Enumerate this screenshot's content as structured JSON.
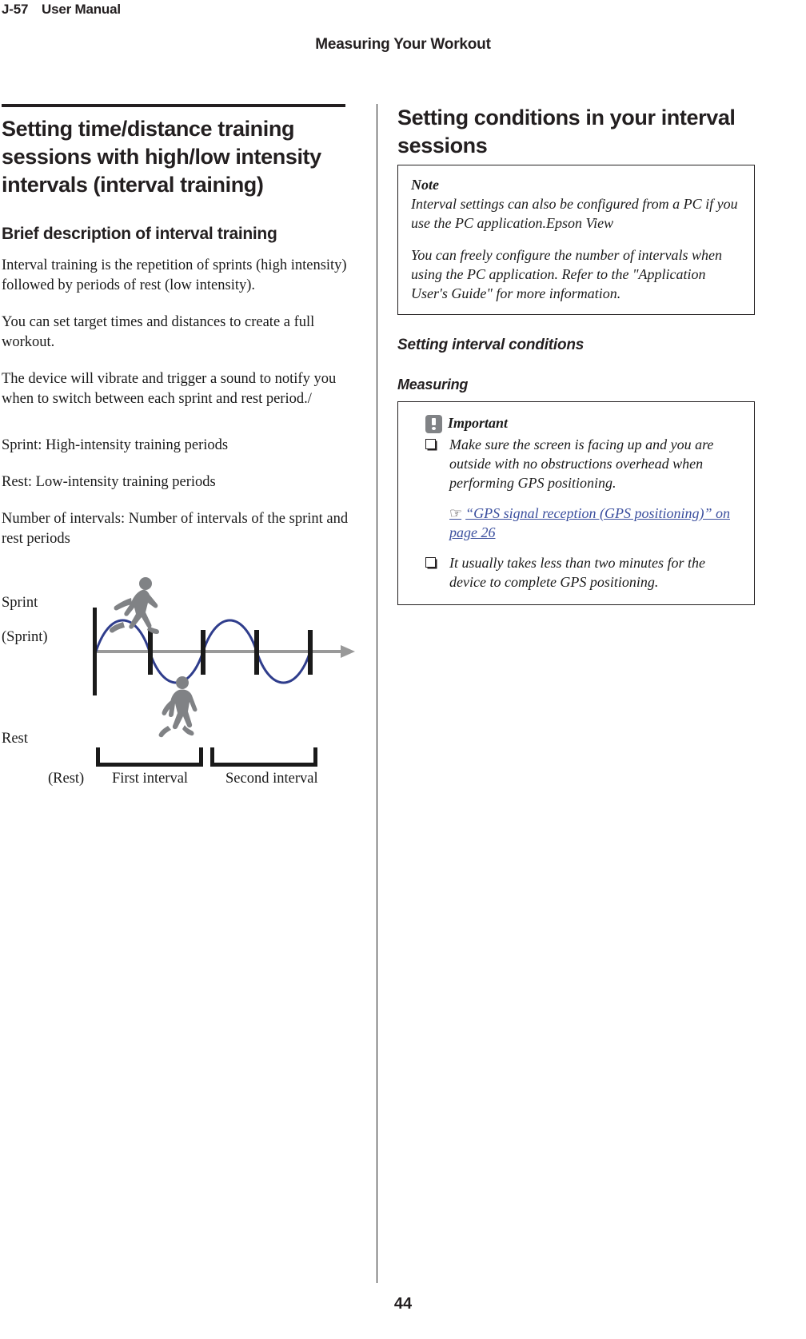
{
  "header": {
    "doc_code": "J-57",
    "doc_name": "User Manual",
    "chapter_title": "Measuring Your Workout"
  },
  "left_column": {
    "main_heading": "Setting time/distance training sessions with high/low intensity intervals (interval training)",
    "section_heading": "Brief description of interval training",
    "paragraphs": [
      "Interval training is the repetition of sprints (high intensity) followed by periods of rest (low intensity).",
      "You can set target times and distances to create a full workout.",
      "The device will vibrate and trigger a sound to notify you when to switch between each sprint and rest period./",
      "Sprint: High-intensity training periods",
      "Rest: Low-intensity training periods",
      "Number of intervals: Number of intervals of the sprint and rest periods"
    ],
    "diagram": {
      "label_sprint": "Sprint",
      "label_sprint_paren": "(Sprint)",
      "label_rest": "Rest",
      "label_rest_paren": "(Rest)",
      "label_first_interval": "First interval",
      "label_second_interval": "Second interval",
      "wave_color": "#2f3d8c",
      "axis_color": "#999999",
      "tick_color": "#1a1a1a",
      "figure_color": "#808285"
    }
  },
  "right_column": {
    "main_heading": "Setting conditions in your interval sessions",
    "note": {
      "title": "Note",
      "paragraphs": [
        "Interval settings can also be configured from a PC if you use the PC application.Epson View",
        "You can freely configure the number of intervals when using the PC application. Refer to the \"Application User's Guide\" for more information."
      ]
    },
    "subheading_italic": "Setting interval conditions",
    "subheading_measuring": "Measuring",
    "important": {
      "title": "Important",
      "bullets": [
        "Make sure the screen is facing up and you are outside with no obstructions overhead when performing GPS positioning.",
        "It usually takes less than two minutes for the device to complete GPS positioning."
      ],
      "cross_reference": "“GPS signal reception (GPS positioning)” on page 26",
      "cross_reference_icon": "pointing-hand-icon",
      "cross_reference_color": "#3b4f9e"
    }
  },
  "footer": {
    "page_number": "44"
  }
}
